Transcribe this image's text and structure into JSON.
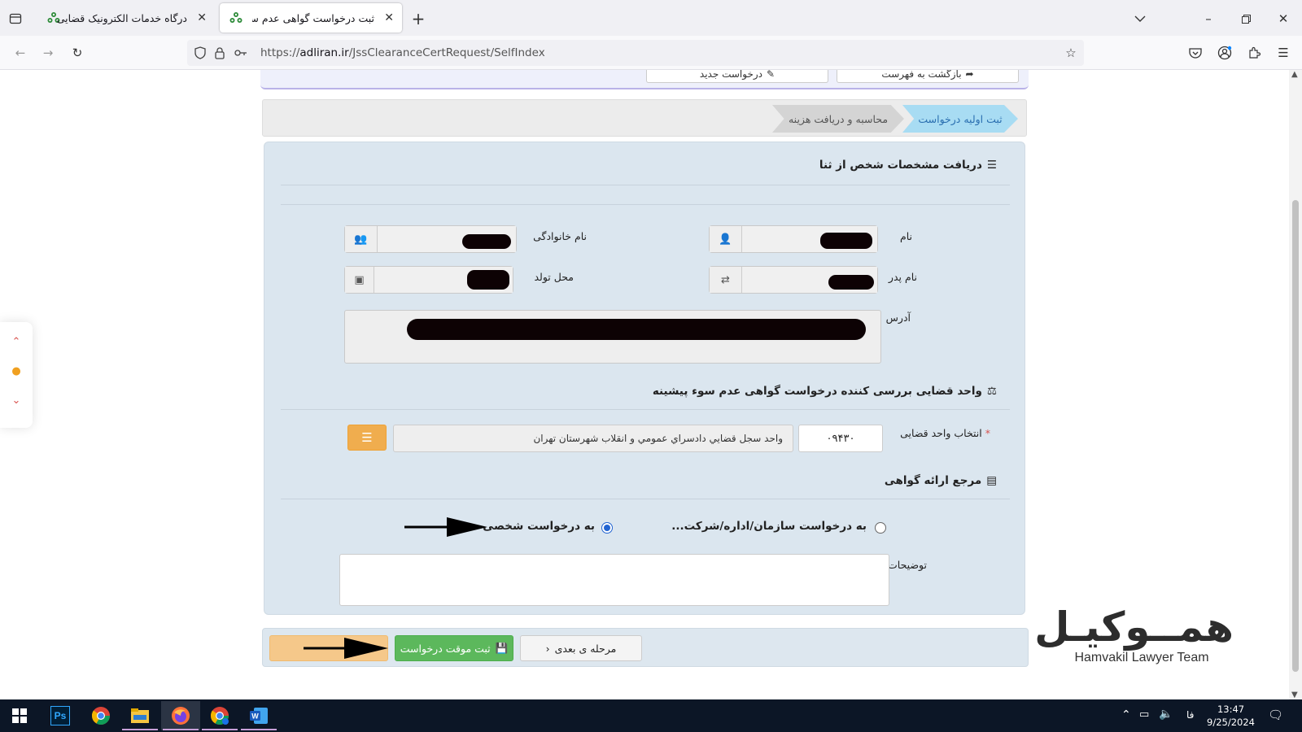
{
  "browser": {
    "tabs": [
      {
        "title": "درگاه خدمات الکترونیک قضایی",
        "active": false
      },
      {
        "title": "ثبت درخواست گواهی عدم سوء پ",
        "active": true
      }
    ],
    "url_host": "adliran.ir",
    "url_path": "/JssClearanceCertRequest/SelfIndex",
    "url_scheme": "https://"
  },
  "top_actions": {
    "new_request": "درخواست جدید",
    "back_to_list": "بازگشت به فهرست"
  },
  "steps": [
    {
      "label": "ثبت اولیه درخواست",
      "active": true
    },
    {
      "label": "محاسبه و دریافت هزینه",
      "active": false
    }
  ],
  "section_person": {
    "title": "دریافت مشخصات شخص از ثنا",
    "first_name_label": "نام",
    "last_name_label": "نام خانوادگی",
    "father_name_label": "نام پدر",
    "birth_place_label": "محل تولد",
    "address_label": "آدرس"
  },
  "section_unit": {
    "title": "واحد قضایی بررسی کننده درخواست گواهی عدم سوء پیشینه",
    "select_label": "انتخاب واحد قضایی",
    "required_mark": "*",
    "unit_code": "۰۹۴۳۰",
    "unit_name": "واحد سجل قضايي دادسراي عمومي و انقلاب شهرستان تهران"
  },
  "section_ref": {
    "title": "مرجع ارائه گواهی",
    "option_org": "به درخواست سازمان/اداره/شرکت...",
    "option_personal": "به درخواست شخصی",
    "selected": "personal",
    "notes_label": "توضیحات"
  },
  "bottom_actions": {
    "next_step": "مرحله ی بعدی",
    "temp_save": "ثبت موقت درخواست"
  },
  "watermark": {
    "brand_fa": "همــوکیـل",
    "brand_en": "Hamvakil Lawyer Team"
  },
  "taskbar": {
    "lang": "فا",
    "time": "13:47",
    "date": "9/25/2024"
  },
  "colors": {
    "panel_bg": "#dbe6ef",
    "step_active": "#a8dcf3",
    "orange_button": "#f0ad4e",
    "green_button": "#5cb85c",
    "taskbar": "#0c1626"
  }
}
